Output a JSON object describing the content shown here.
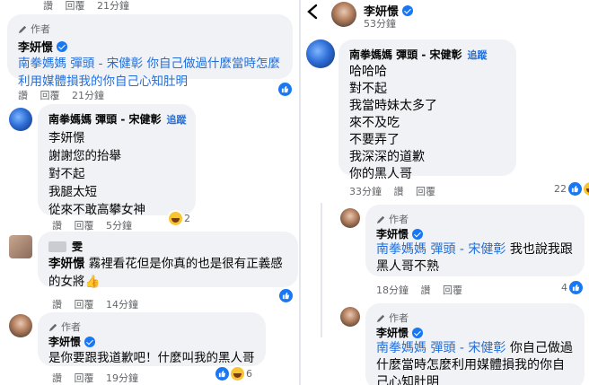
{
  "left": {
    "top_meta": {
      "like": "讚",
      "reply": "回覆",
      "time": "21分鐘"
    },
    "c1": {
      "author_badge": "作者",
      "name": "李妍憬",
      "text": "南拳媽媽 彈頭 - 宋健彰 你自己做過什麼當時怎麼利用媒體損我的你自己心知肚明",
      "like": "讚",
      "reply": "回覆",
      "time": "21分鐘"
    },
    "c2": {
      "name": "南拳媽媽 彈頭 - 宋健彰",
      "follow": "追蹤",
      "lines": [
        "李妍憬",
        "謝謝您的抬舉",
        "對不起",
        "我腿太短",
        "從來不敢高攀女神"
      ],
      "like": "讚",
      "reply": "回覆",
      "time": "5分鐘",
      "reaction_count": "2"
    },
    "c3": {
      "name_suffix": "雯",
      "mention": "李妍憬",
      "text": "霧裡看花但是你真的也是很有正義感的女將👍",
      "like": "讚",
      "reply": "回覆",
      "time": "14分鐘"
    },
    "c4": {
      "author_badge": "作者",
      "name": "李妍憬",
      "text": "是你要跟我道歉吧！什麼叫我的黑人哥",
      "like": "讚",
      "reply": "回覆",
      "time": "19分鐘",
      "reaction_count": "6"
    }
  },
  "right": {
    "header": {
      "name": "李妍憬",
      "time": "53分鐘"
    },
    "c1": {
      "name": "南拳媽媽 彈頭 - 宋健彰",
      "follow": "追蹤",
      "lines": [
        "哈哈哈",
        "對不起",
        "我當時妹太多了",
        "來不及吃",
        "不要弄了",
        "我深深的道歉",
        "你的黑人哥"
      ],
      "time": "33分鐘",
      "like": "讚",
      "reply": "回覆",
      "like_count": "22"
    },
    "c2": {
      "author_badge": "作者",
      "name": "李妍憬",
      "mention": "南拳媽媽 彈頭 - 宋健彰",
      "text": "我也說我跟黑人哥不熟",
      "time": "18分鐘",
      "like": "讚",
      "reply": "回覆",
      "like_count": "4"
    },
    "c3": {
      "author_badge": "作者",
      "name": "李妍憬",
      "mention": "南拳媽媽 彈頭 - 宋健彰",
      "text": "你自己做過什麼當時怎麼利用媒體損我的你自己心知肚明"
    }
  },
  "colors": {
    "accent": "#1877f2",
    "mention": "#216fdb",
    "bubble": "#f0f2f5",
    "meta": "#65676b"
  }
}
